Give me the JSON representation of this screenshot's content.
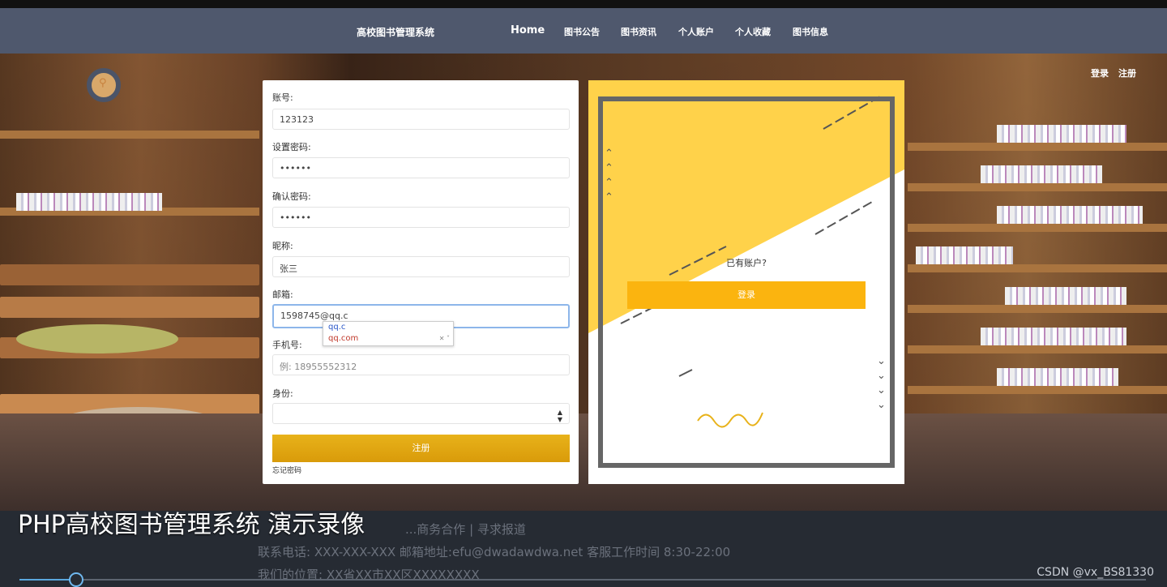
{
  "nav": {
    "brand": "高校图书管理系统",
    "items": [
      "Home",
      "图书公告",
      "图书资讯",
      "个人账户",
      "个人收藏",
      "图书信息"
    ]
  },
  "auth": {
    "login": "登录",
    "register": "注册"
  },
  "form": {
    "account_label": "账号:",
    "account_value": "123123",
    "password_label": "设置密码:",
    "password_value": "••••••",
    "confirm_label": "确认密码:",
    "confirm_value": "••••••",
    "nickname_label": "昵称:",
    "nickname_value": "张三",
    "email_label": "邮箱:",
    "email_value": "1598745@qq.c",
    "phone_label": "手机号:",
    "phone_placeholder": "例: 18955552312",
    "identity_label": "身份:",
    "identity_value": "",
    "submit_label": "注册",
    "forgot_label": "忘记密码"
  },
  "autocomplete": {
    "typed": "qq.c",
    "suggestion": "qq.com",
    "controls": "✕ ˅"
  },
  "promo": {
    "question": "已有账户?",
    "login_button": "登录"
  },
  "footer": {
    "links_line": "...商务合作 | 寻求报道",
    "contact_line": "联系电话:  XXX-XXX-XXX 邮箱地址:efu@dwadawdwa.net 客服工作时间 8:30-22:00",
    "address_line": "我们的位置: XX省XX市XX区XXXXXXXX"
  },
  "video": {
    "title": "PHP高校图书管理系统 演示录像",
    "progress": 0.05,
    "watermark": "CSDN @vx_BS81330"
  },
  "colors": {
    "nav_bg": "#4f586d",
    "accent_yellow": "#fbb40f",
    "promo_yellow": "#ffd24a",
    "footer_bg": "#262b33"
  }
}
